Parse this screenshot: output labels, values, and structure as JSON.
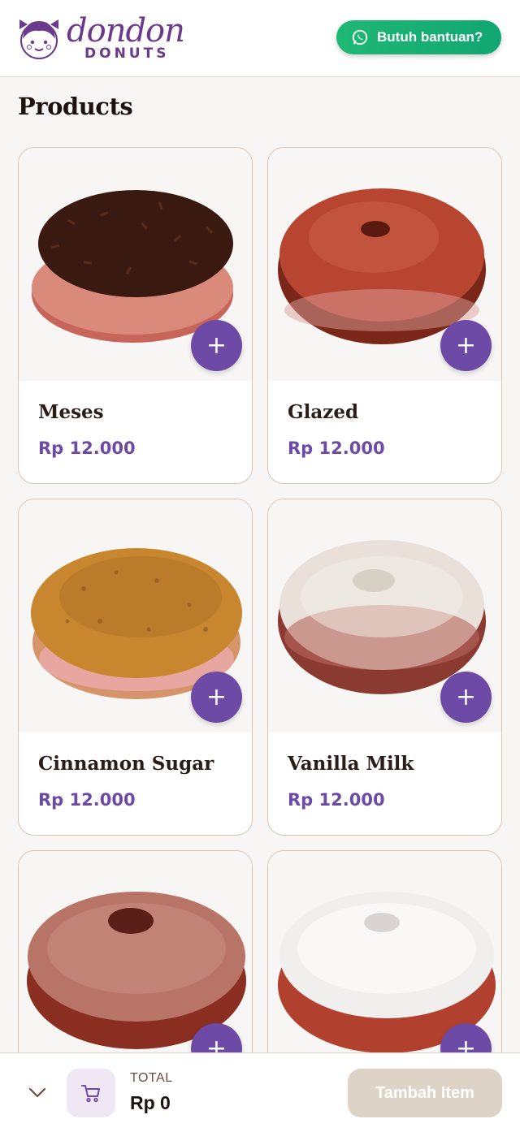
{
  "header": {
    "brand_script": "dondon",
    "brand_sub": "DONUTS",
    "help_label": "Butuh bantuan?"
  },
  "page_title": "Products",
  "products": [
    {
      "name": "Meses",
      "price": "Rp 12.000",
      "icon": "chocolate-sprinkle-donut-image"
    },
    {
      "name": "Glazed",
      "price": "Rp 12.000",
      "icon": "glazed-donut-image"
    },
    {
      "name": "Cinnamon Sugar",
      "price": "Rp 12.000",
      "icon": "cinnamon-sugar-donut-image"
    },
    {
      "name": "Vanilla Milk",
      "price": "Rp 12.000",
      "icon": "vanilla-milk-donut-image"
    },
    {
      "name": "",
      "price": "",
      "icon": "cocoa-powder-donut-image"
    },
    {
      "name": "",
      "price": "",
      "icon": "powdered-sugar-donut-image"
    }
  ],
  "add_symbol": "+",
  "footer": {
    "total_label": "TOTAL",
    "total_value": "Rp 0",
    "action_label": "Tambah Item"
  },
  "colors": {
    "accent": "#6d4aa6",
    "whatsapp": "#1fb874",
    "disabled_button": "#ddd3c6"
  }
}
